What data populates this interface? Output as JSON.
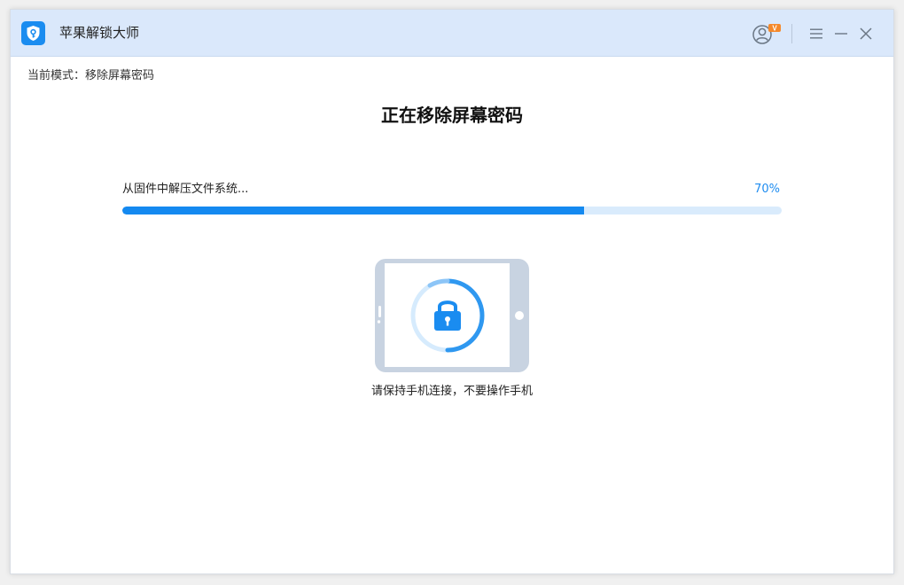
{
  "app": {
    "title": "苹果解锁大师",
    "badge_text": "V",
    "colors": {
      "accent": "#1489f0",
      "titlebar": "#dae8fb",
      "badge": "#f5892b"
    }
  },
  "titlebar": {
    "icons": [
      "app-logo-icon",
      "user-account-icon",
      "menu-icon",
      "minimize-icon",
      "close-icon"
    ]
  },
  "mode": {
    "text": "当前模式：移除屏幕密码"
  },
  "main": {
    "title": "正在移除屏幕密码"
  },
  "progress": {
    "label": "从固件中解压文件系统...",
    "percent_text": "70%",
    "value": 0.7
  },
  "illustration": {
    "icons": [
      "tablet-icon",
      "lock-icon",
      "progress-ring-icon"
    ]
  },
  "hint": {
    "text": "请保持手机连接，不要操作手机"
  }
}
